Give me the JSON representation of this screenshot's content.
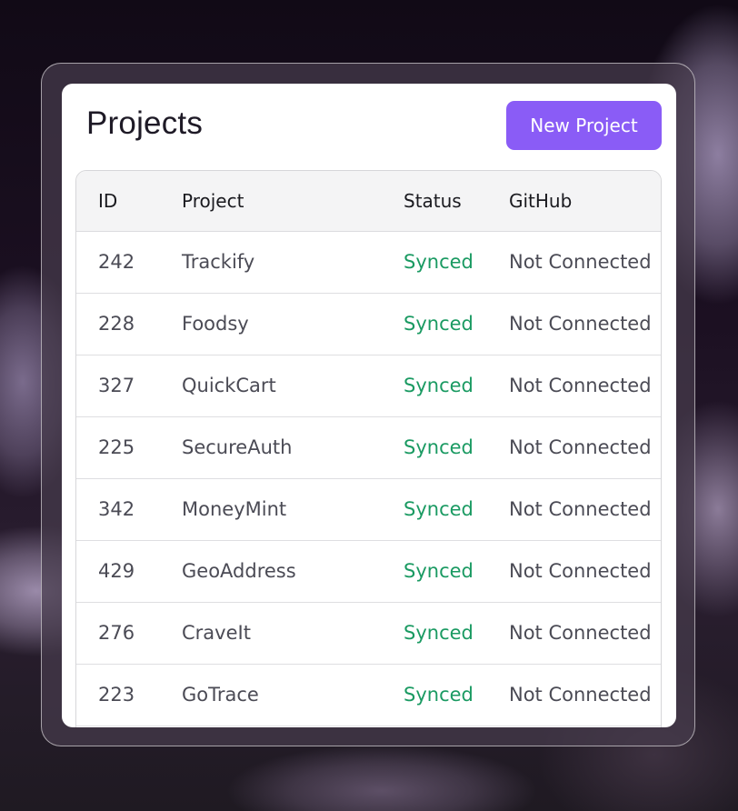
{
  "page": {
    "title": "Projects",
    "new_button_label": "New Project"
  },
  "table": {
    "columns": [
      "ID",
      "Project",
      "Status",
      "GitHub"
    ],
    "rows": [
      {
        "id": "242",
        "project": "Trackify",
        "status": "Synced",
        "github": "Not Connected"
      },
      {
        "id": "228",
        "project": "Foodsy",
        "status": "Synced",
        "github": "Not Connected"
      },
      {
        "id": "327",
        "project": "QuickCart",
        "status": "Synced",
        "github": "Not Connected"
      },
      {
        "id": "225",
        "project": "SecureAuth",
        "status": "Synced",
        "github": "Not Connected"
      },
      {
        "id": "342",
        "project": "MoneyMint",
        "status": "Synced",
        "github": "Not Connected"
      },
      {
        "id": "429",
        "project": "GeoAddress",
        "status": "Synced",
        "github": "Not Connected"
      },
      {
        "id": "276",
        "project": "CraveIt",
        "status": "Synced",
        "github": "Not Connected"
      },
      {
        "id": "223",
        "project": "GoTrace",
        "status": "Synced",
        "github": "Not Connected"
      }
    ]
  },
  "colors": {
    "accent": "#8a5cf6",
    "status_synced": "#1a9a62",
    "text_primary": "#1e1a26",
    "text_secondary": "#4b4b55"
  }
}
